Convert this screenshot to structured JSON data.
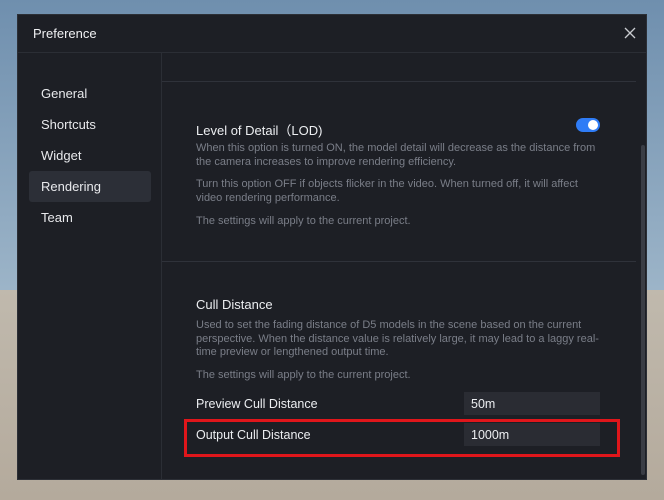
{
  "dialog": {
    "title": "Preference",
    "close_icon": "close-icon"
  },
  "sidebar": {
    "items": [
      {
        "label": "General",
        "active": false
      },
      {
        "label": "Shortcuts",
        "active": false
      },
      {
        "label": "Widget",
        "active": false
      },
      {
        "label": "Rendering",
        "active": true
      },
      {
        "label": "Team",
        "active": false
      }
    ]
  },
  "lod": {
    "title": "Level of Detail（LOD)",
    "enabled": true,
    "desc1": "When this option is turned ON, the model detail will decrease as the distance from the camera increases to improve rendering efficiency.",
    "desc2": "Turn this option OFF if objects flicker in the video. When turned off, it will affect video rendering performance.",
    "desc3": "The settings will apply to the current project."
  },
  "cull": {
    "title": "Cull Distance",
    "desc1": "Used to set the fading distance of D5 models in the scene based on the current perspective. When the distance value is relatively large, it may lead to a laggy real-time preview or lengthened output time.",
    "desc2": "The settings will apply to the current project.",
    "preview_label": "Preview Cull Distance",
    "preview_value": "50m",
    "output_label": "Output Cull Distance",
    "output_value": "1000m"
  },
  "colors": {
    "accent": "#2f7cf6",
    "highlight": "#e0161b",
    "dialog_bg": "#1d1f25"
  }
}
